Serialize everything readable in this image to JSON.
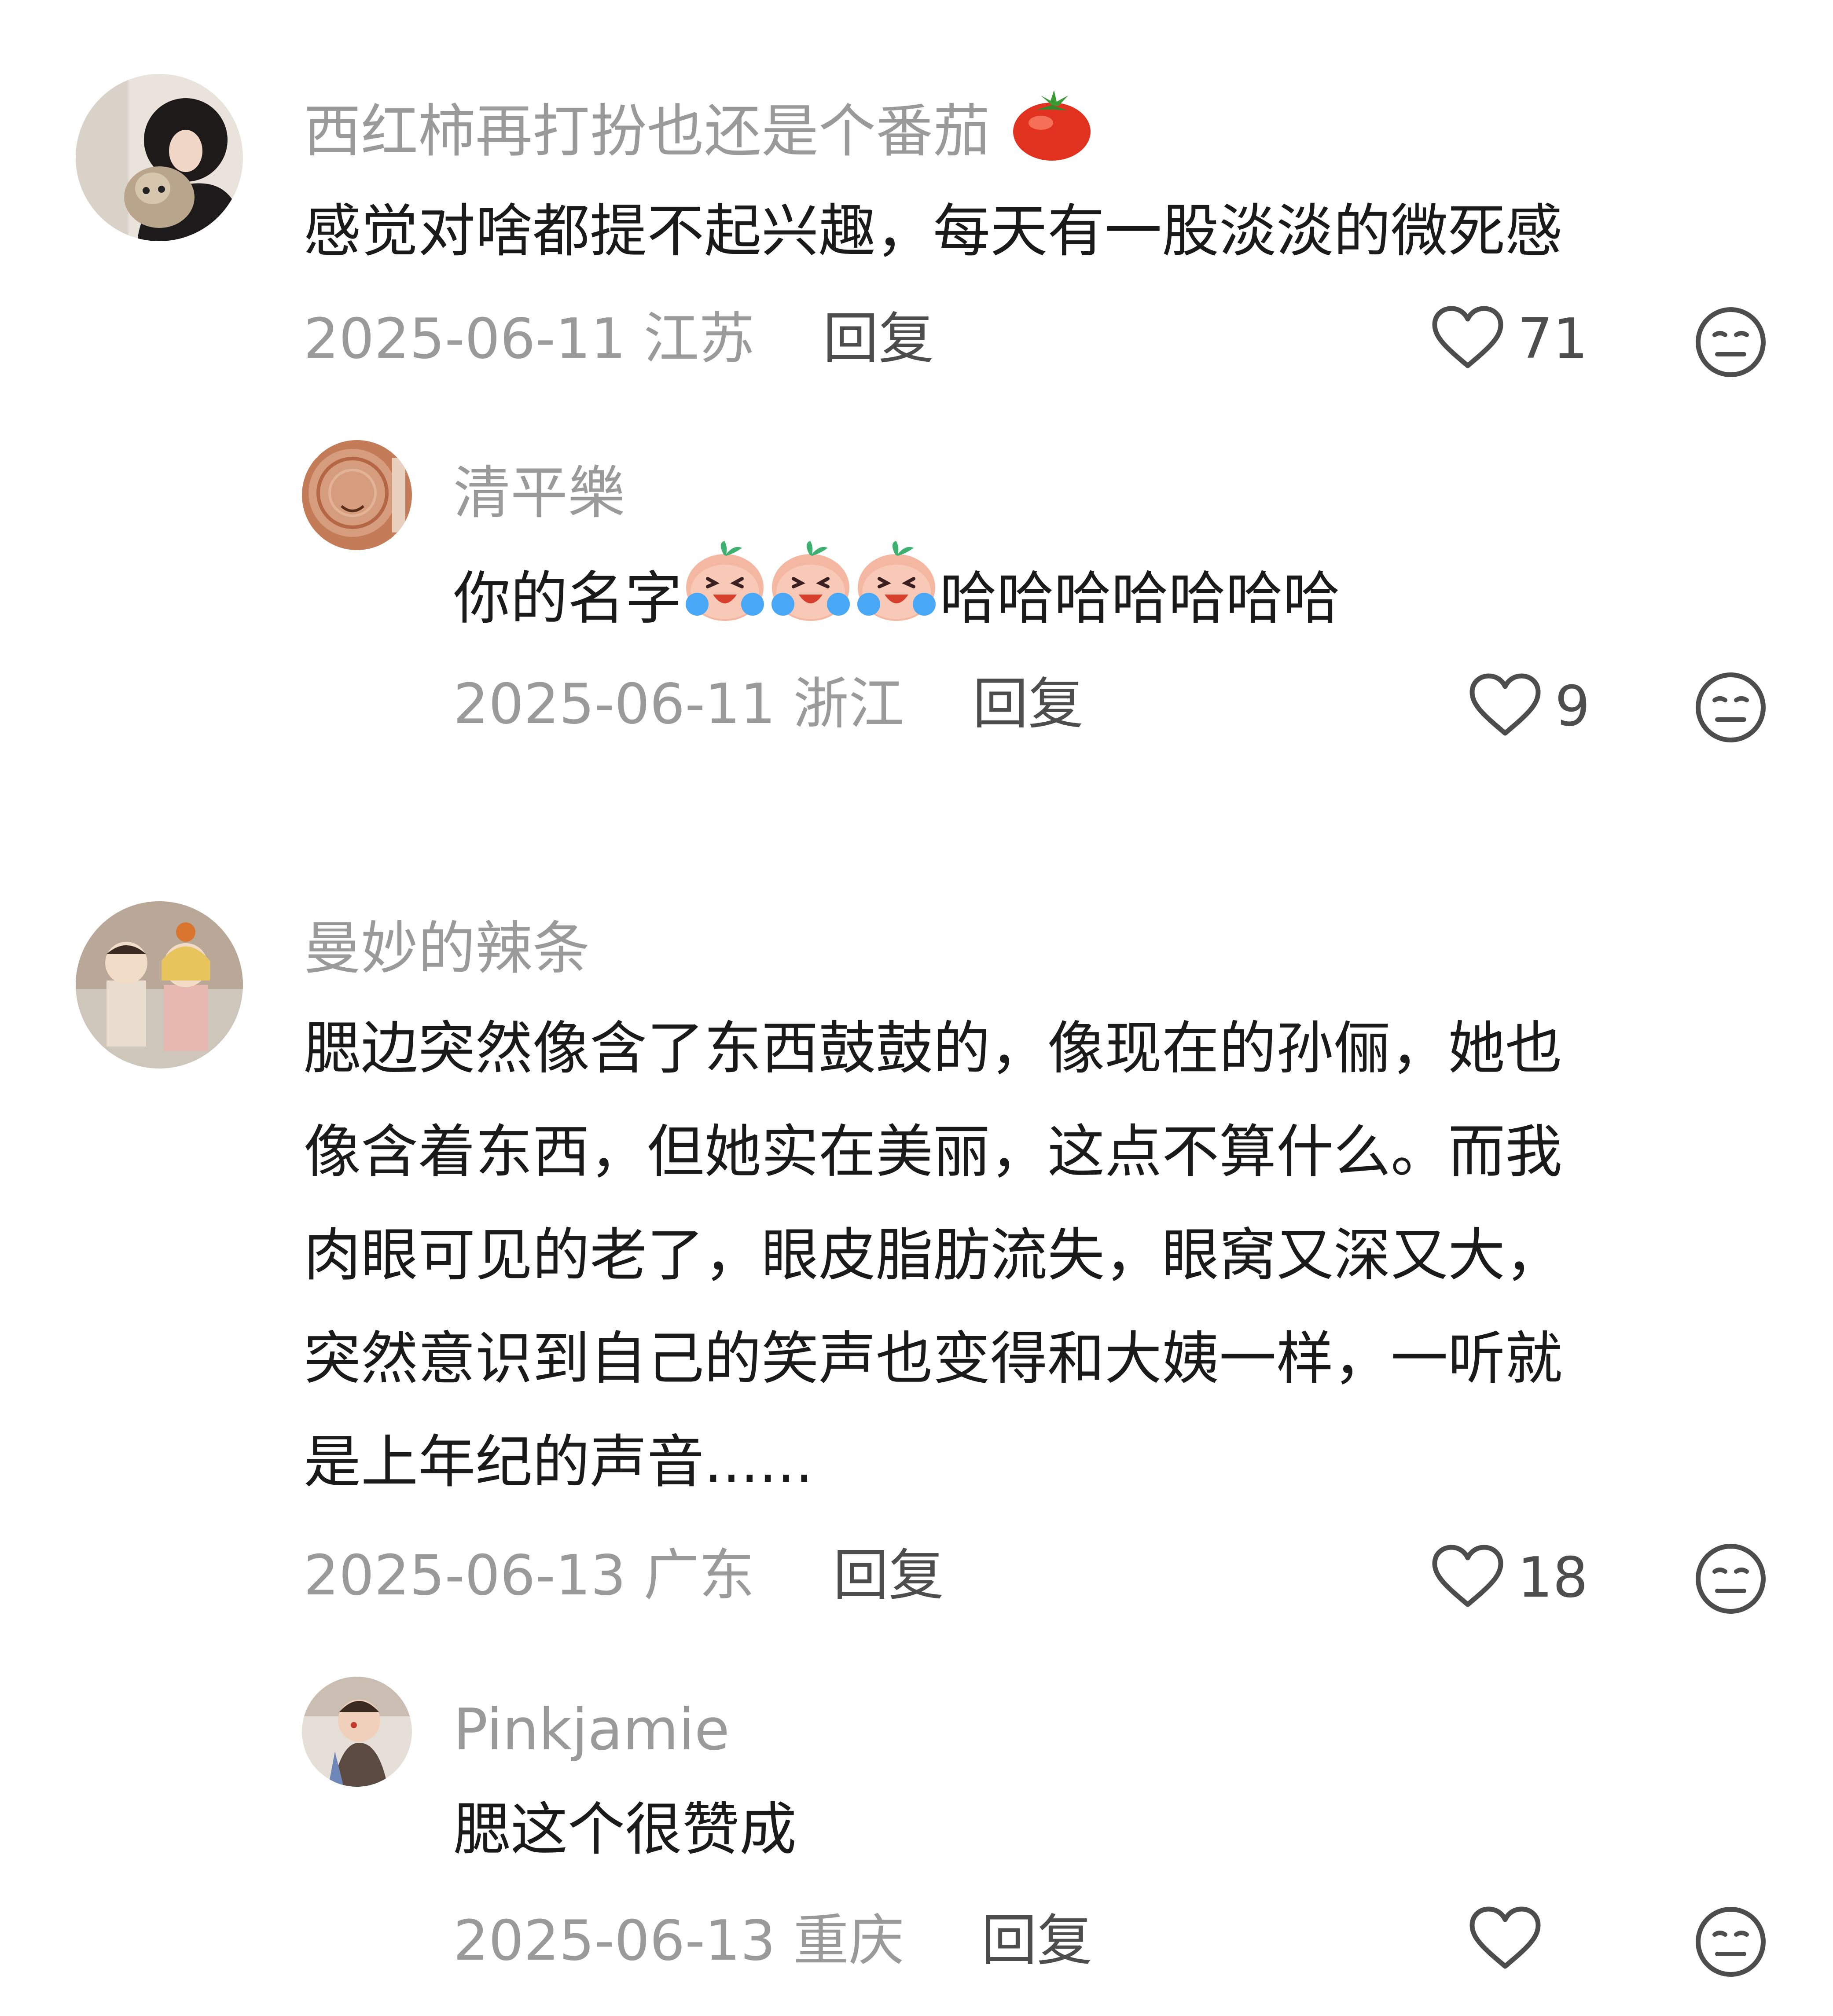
{
  "comments": [
    {
      "username": "西红柿再打扮也还是个番茄",
      "text": "感觉对啥都提不起兴趣，每天有一股淡淡的微死感",
      "date": "2025-06-11",
      "location": "江苏",
      "reply_label": "回复",
      "likes": "71",
      "emoji_in_name": "tomato-emoji",
      "replies": [
        {
          "username": "清平樂",
          "text_before": "你的名字",
          "text_after": "哈哈哈哈哈哈哈",
          "inline_emoji": "crying-laughing-peach-sticker",
          "inline_emoji_count": 3,
          "date": "2025-06-11",
          "location": "浙江",
          "reply_label": "回复",
          "likes": "9"
        }
      ]
    },
    {
      "username": "曼妙的辣条",
      "text_lines": [
        "腮边突然像含了东西鼓鼓的，像现在的孙俪，她也",
        "像含着东西，但她实在美丽，这点不算什么。而我",
        "肉眼可见的老了，眼皮脂肪流失，眼窝又深又大，",
        "突然意识到自己的笑声也变得和大姨一样，一听就",
        "是上年纪的声音......"
      ],
      "date": "2025-06-13",
      "location": "广东",
      "reply_label": "回复",
      "likes": "18",
      "replies": [
        {
          "username": "Pinkjamie",
          "text": "腮这个很赞成",
          "date": "2025-06-13",
          "location": "重庆",
          "reply_label": "回复",
          "likes": ""
        }
      ]
    }
  ],
  "colors": {
    "username": "#9a9a9a",
    "body": "#1a1a1a",
    "meta": "#9a9a9a",
    "action": "#4d4d4d",
    "icon": "#4d4d4d"
  },
  "icons": {
    "like": "heart-outline-icon",
    "dislike": "meh-face-icon"
  }
}
